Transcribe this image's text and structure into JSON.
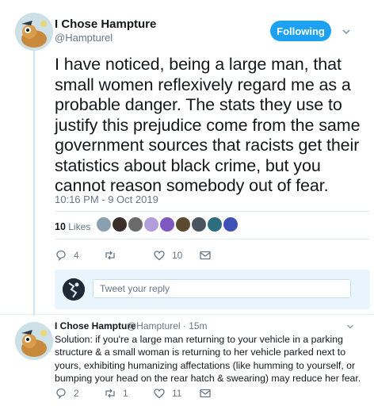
{
  "tweet": {
    "author_name": "I Chose Hampture",
    "author_handle": "@Hampturel",
    "follow_label": "Following",
    "text": "I have noticed, being a large man, that small women reflexively regard me as a probable danger. The stats they use to justify this prejudice come from the same government sources that racists get their statistics about black crime, but you cannot reason somebody out of fear.",
    "timestamp": "10:16 PM - 9 Oct 2019",
    "likes_count": "10",
    "likes_label": "Likes",
    "liker_colors": [
      "#8aa0b0",
      "#3a2f2a",
      "#6b6b6b",
      "#b39ddb",
      "#7e57c2",
      "#5a4a30",
      "#4a5560",
      "#2c6e7d",
      "#3f51b5"
    ],
    "replies": "4",
    "retweets": "",
    "likes": "10"
  },
  "reply_box": {
    "placeholder": "Tweet your reply"
  },
  "reply": {
    "author_name": "I Chose Hampture",
    "author_handle": "@Hampturel · 15m",
    "text": "Solution: if you're a large man returning to your vehicle in a parking structure & a small woman is returning to her vehicle parked next to yours, exhibiting humanizing affectations (like humming to yourself, or bumping your head on the rear hatch & swearing) may reduce her fear.",
    "replies": "2",
    "retweets": "1",
    "likes": "11"
  },
  "colors": {
    "accent": "#1da1f2",
    "secondary_text": "#657786",
    "thread_line": "#cfe3f2"
  }
}
